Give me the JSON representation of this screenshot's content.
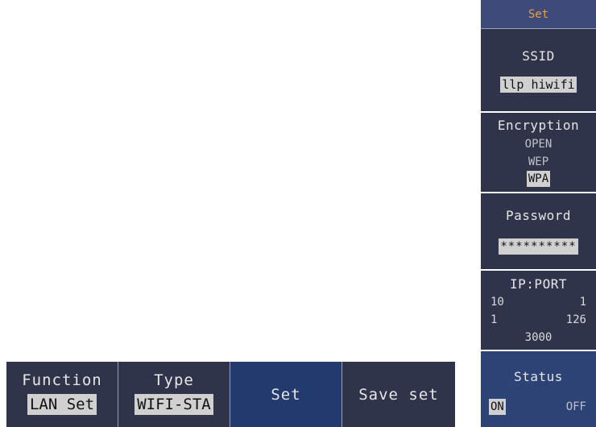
{
  "side_menu": {
    "title": "Set",
    "ssid": {
      "label": "SSID",
      "value": "llp hiwifi"
    },
    "encryption": {
      "label": "Encryption",
      "options": [
        "OPEN",
        "WEP",
        "WPA"
      ],
      "selected": "WPA"
    },
    "password": {
      "label": "Password",
      "value": "**********"
    },
    "ip_port": {
      "label": "IP:PORT",
      "ip_row1": [
        "10",
        "1"
      ],
      "ip_row2": [
        "1",
        "126"
      ],
      "port": "3000"
    },
    "status": {
      "label": "Status",
      "on": "ON",
      "off": "OFF",
      "selected": "ON"
    }
  },
  "bottom_menu": {
    "function": {
      "label": "Function",
      "value": "LAN Set"
    },
    "type": {
      "label": "Type",
      "value": "WIFI-STA"
    },
    "set": {
      "label": "Set"
    },
    "save_set": {
      "label": "Save set"
    }
  },
  "colors": {
    "menu_bg": "#30344a",
    "active_bg": "#233a6e",
    "title_text": "#e8a040",
    "highlight_bg": "#d0d0d0"
  }
}
